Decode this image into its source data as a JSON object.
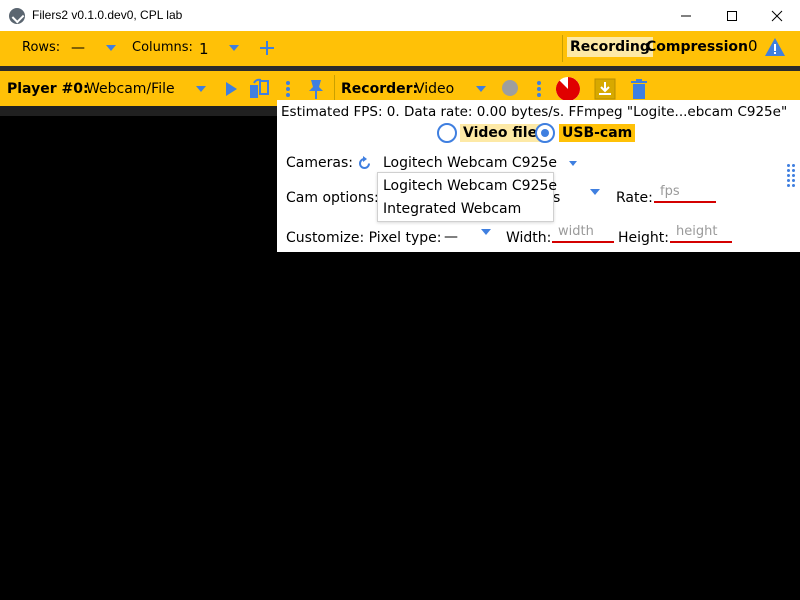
{
  "window": {
    "title": "Filers2 v0.1.0.dev0, CPL lab"
  },
  "toolbar_top": {
    "rows_label": "Rows:",
    "rows_value": "—",
    "columns_label": "Columns:",
    "columns_value": "1",
    "add_icon": "plus-icon",
    "recording_tab": "Recording",
    "compression_tab": "Compression",
    "warning_count": "0",
    "warning_icon": "warning-icon"
  },
  "player_bar": {
    "player_label": "Player #0:",
    "player_source": "Webcam/File",
    "recorder_label": "Recorder:",
    "recorder_value": "Video"
  },
  "panel": {
    "status_text": "Estimated FPS: 0. Data rate: 0.00 bytes/s. FFmpeg \"Logite...ebcam C925e\"",
    "source_options": [
      {
        "label": "Video file",
        "selected": false
      },
      {
        "label": "USB-cam",
        "selected": true
      }
    ],
    "cameras_label": "Cameras:",
    "camera_selected": "Logitech Webcam C925e",
    "cam_options_label": "Cam options:",
    "cam_options_value_tail": "s",
    "rate_label": "Rate:",
    "rate_placeholder": "fps",
    "customize_label": "Customize: Pixel type:",
    "pixel_type_value": "—",
    "width_label": "Width:",
    "width_placeholder": "width",
    "height_label": "Height:",
    "height_placeholder": "height"
  },
  "camera_dropdown": {
    "options": [
      "Logitech Webcam C925e",
      "Integrated Webcam"
    ]
  },
  "colors": {
    "accent_yellow": "#ffc107",
    "accent_blue": "#3f7fe0",
    "highlight_tab": "#fde9a6",
    "record_red": "#e00000",
    "underline_red": "#d40000"
  }
}
